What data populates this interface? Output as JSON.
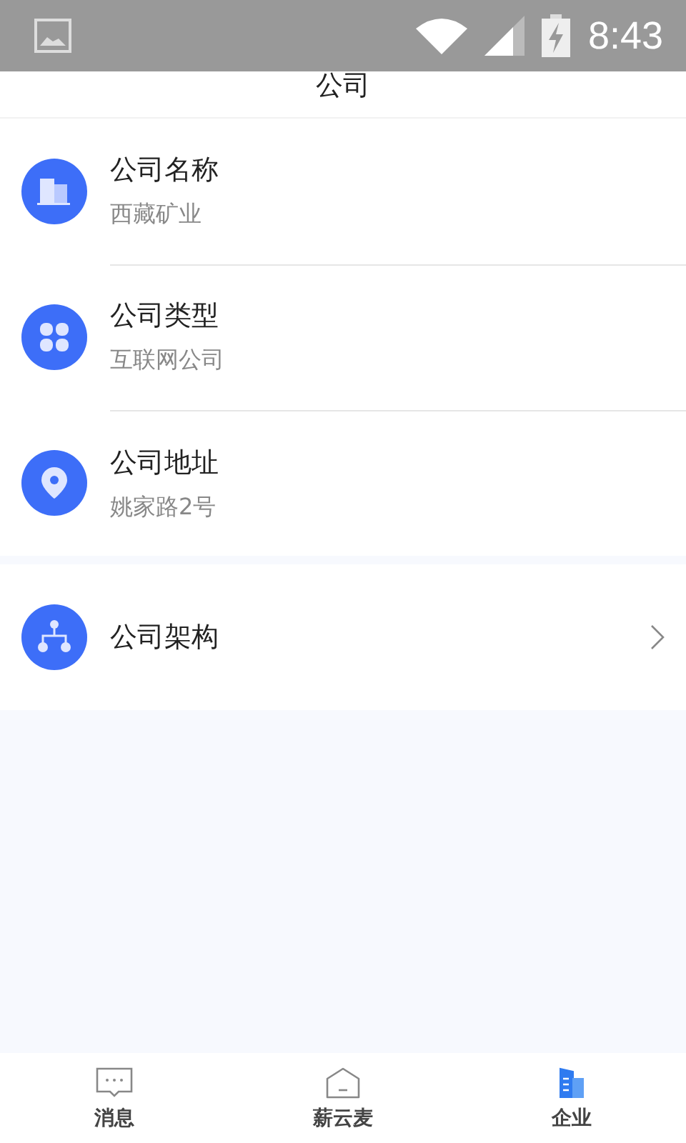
{
  "status_bar": {
    "time": "8:43"
  },
  "header": {
    "title": "公司"
  },
  "info_items": [
    {
      "title": "公司名称",
      "value": "西藏矿业"
    },
    {
      "title": "公司类型",
      "value": "互联网公司"
    },
    {
      "title": "公司地址",
      "value": "姚家路2号"
    }
  ],
  "link_items": [
    {
      "title": "公司架构"
    }
  ],
  "tab_bar": [
    {
      "label": "消息",
      "selected": false
    },
    {
      "label": "薪云麦",
      "selected": false
    },
    {
      "label": "企业",
      "selected": true
    }
  ]
}
